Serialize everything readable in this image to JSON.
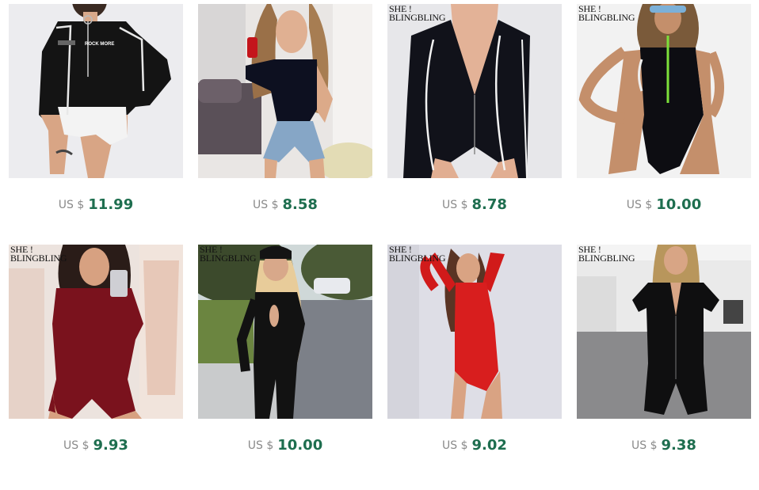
{
  "products": [
    {
      "currency": "US $",
      "price": "11.99",
      "photo": "model-black-bodysuit-white-shorts-icon",
      "watermark": null
    },
    {
      "currency": "US $",
      "price": "8.58",
      "photo": "model-one-shoulder-bodysuit-selfie-icon",
      "watermark": null
    },
    {
      "currency": "US $",
      "price": "8.78",
      "photo": "black-zip-bodysuit-closeup-icon",
      "watermark": {
        "top": "SHE !",
        "bottom": "BLINGBLING"
      }
    },
    {
      "currency": "US $",
      "price": "10.00",
      "photo": "model-black-zip-swimsuit-icon",
      "watermark": {
        "top": "SHE !",
        "bottom": "BLINGBLING"
      }
    },
    {
      "currency": "US $",
      "price": "9.93",
      "photo": "model-burgundy-bodysuit-selfie-icon",
      "watermark": {
        "top": "SHE !",
        "bottom": "BLINGBLING"
      }
    },
    {
      "currency": "US $",
      "price": "10.00",
      "photo": "model-black-keyhole-bodysuit-street-icon",
      "watermark": {
        "top": "SHE !",
        "bottom": "BLINGBLING"
      }
    },
    {
      "currency": "US $",
      "price": "9.02",
      "photo": "model-red-bodysuit-icon",
      "watermark": {
        "top": "SHE !",
        "bottom": "BLINGBLING"
      }
    },
    {
      "currency": "US $",
      "price": "9.38",
      "photo": "model-black-zip-romper-icon",
      "watermark": {
        "top": "SHE !",
        "bottom": "BLINGBLING"
      }
    }
  ],
  "colors": {
    "price": "#1e6e4f",
    "currency": "#8a8a8a",
    "background": "#ffffff"
  }
}
